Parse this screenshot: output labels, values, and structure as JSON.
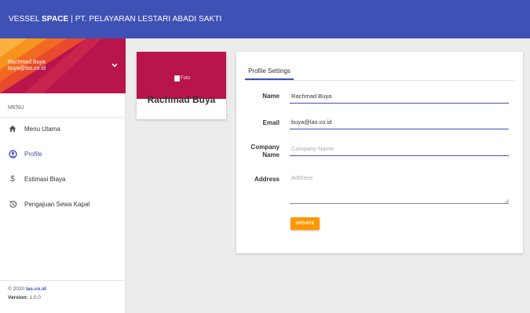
{
  "topbar": {
    "brand_prefix": "VESSEL ",
    "brand_bold": "SPACE",
    "brand_suffix": " | PT. PELAYARAN LESTARI ABADI SAKTI"
  },
  "sidebar": {
    "user": {
      "name": "Rachmad Buya",
      "email": "buya@las.co.id"
    },
    "menu_header": "MENU",
    "items": [
      {
        "label": "Menu Utama",
        "icon": "home-icon"
      },
      {
        "label": "Profile",
        "icon": "account-circle-icon",
        "active": true
      },
      {
        "label": "Estimasi Biaya",
        "icon": "dollar-icon"
      },
      {
        "label": "Pengajuan Sewa Kapal",
        "icon": "history-icon"
      }
    ],
    "footer": {
      "copy_prefix": "© 2020 ",
      "copy_link": "las.co.id",
      "version_label": "Version: ",
      "version_value": "1.0.0"
    }
  },
  "profile_card": {
    "image_alt": "Foto",
    "name": "Rachmad Buya"
  },
  "settings": {
    "tab": "Profile Settings",
    "fields": {
      "name": {
        "label": "Name",
        "value": "Rachmad Buya",
        "placeholder": ""
      },
      "email": {
        "label": "Email",
        "value": "buya@las.co.id",
        "placeholder": ""
      },
      "company": {
        "label_line1": "Company",
        "label_line2": "Name",
        "value": "",
        "placeholder": "Company Name"
      },
      "address": {
        "label": "Address",
        "value": "",
        "placeholder": "Address"
      }
    },
    "update_button": "UPDATE"
  },
  "colors": {
    "primary": "#3f51b5",
    "accent": "#b7154c",
    "button": "#ff9800"
  }
}
